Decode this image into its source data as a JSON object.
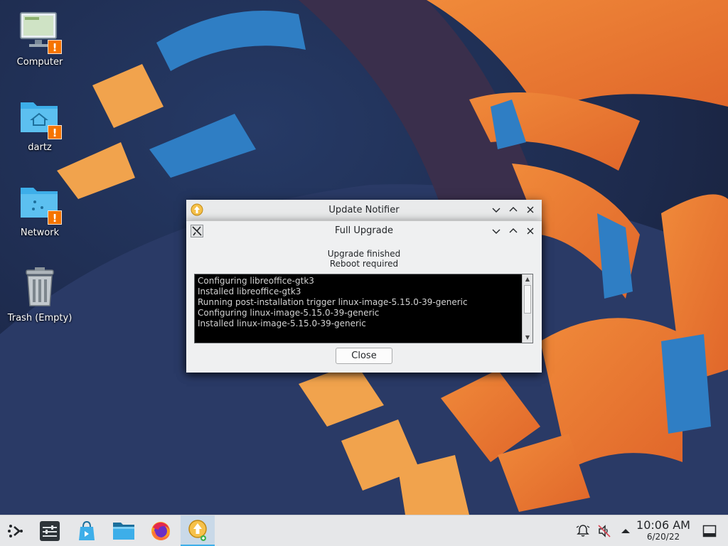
{
  "desktop": {
    "icons": [
      {
        "label": "Computer",
        "icon": "computer-icon"
      },
      {
        "label": "dartz",
        "icon": "home-folder-icon"
      },
      {
        "label": "Network",
        "icon": "network-folder-icon"
      },
      {
        "label": "Trash (Empty)",
        "icon": "trash-icon"
      }
    ],
    "badge_text": "!"
  },
  "windows": {
    "outer": {
      "title": "Update Notifier"
    },
    "inner": {
      "title": "Full Upgrade",
      "status_line1": "Upgrade finished",
      "status_line2": "Reboot required",
      "log": [
        "Configuring libreoffice-gtk3",
        "Installed libreoffice-gtk3",
        "Running post-installation trigger linux-image-5.15.0-39-generic",
        "Configuring linux-image-5.15.0-39-generic",
        "Installed linux-image-5.15.0-39-generic"
      ],
      "close_label": "Close"
    }
  },
  "taskbar": {
    "launchers": [
      "app-launcher-icon",
      "system-settings-icon",
      "discover-icon",
      "dolphin-icon",
      "firefox-icon",
      "update-notifier-icon"
    ],
    "tray": [
      "notifications-icon",
      "volume-muted-icon",
      "show-hidden-icons-icon"
    ],
    "clock": {
      "time": "10:06 AM",
      "date": "6/20/22"
    },
    "show_desktop": "show-desktop-icon"
  },
  "colors": {
    "accent": "#3daee9",
    "warning": "#f67400",
    "panel": "#e6e7e9",
    "window": "#eff0f1"
  }
}
